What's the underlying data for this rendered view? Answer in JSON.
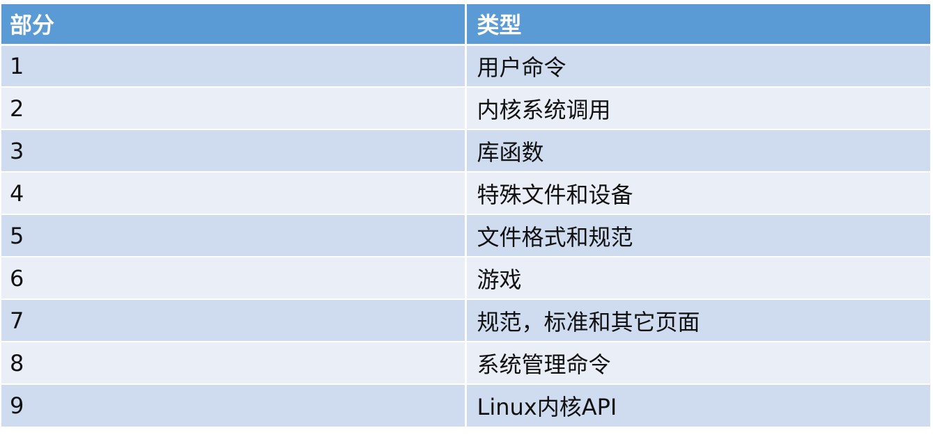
{
  "table": {
    "headers": [
      "部分",
      "类型"
    ],
    "rows": [
      {
        "section": "1",
        "type": "用户命令"
      },
      {
        "section": "2",
        "type": "内核系统调用"
      },
      {
        "section": "3",
        "type": "库函数"
      },
      {
        "section": "4",
        "type": "特殊文件和设备"
      },
      {
        "section": "5",
        "type": "文件格式和规范"
      },
      {
        "section": "6",
        "type": "游戏"
      },
      {
        "section": "7",
        "type": "规范，标准和其它页面"
      },
      {
        "section": "8",
        "type": "系统管理命令"
      },
      {
        "section": "9",
        "type": "Linux内核API"
      }
    ]
  },
  "colors": {
    "header_bg": "#5b9bd5",
    "row_odd_bg": "#cfdcef",
    "row_even_bg": "#e9eef7"
  }
}
